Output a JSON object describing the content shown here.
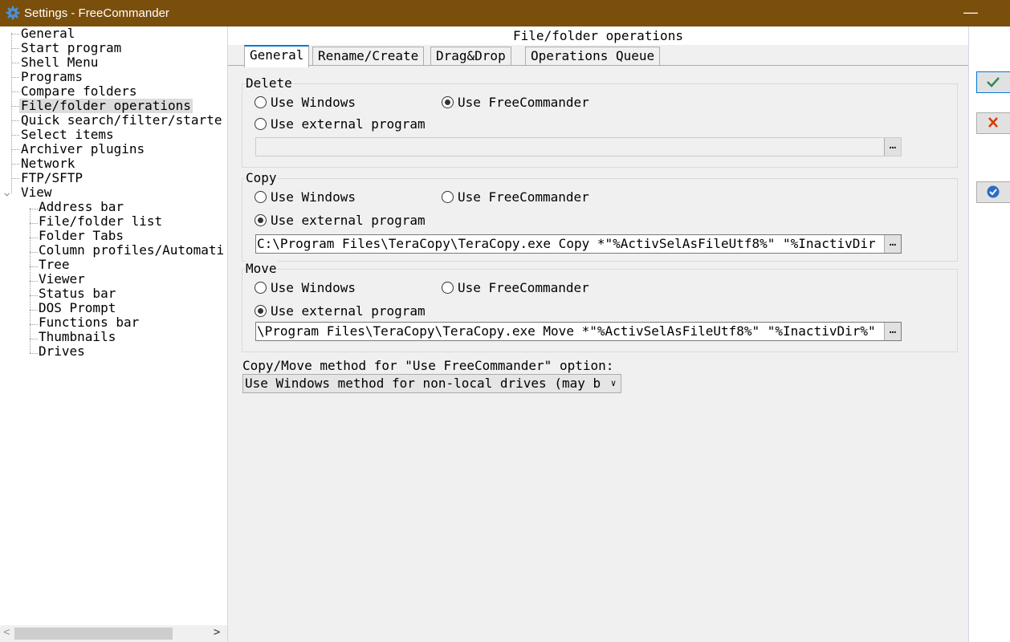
{
  "window": {
    "title": "Settings - FreeCommander",
    "minimize": "—"
  },
  "tree": {
    "items": [
      "General",
      "Start program",
      "Shell Menu",
      "Programs",
      "Compare folders",
      "File/folder operations",
      "Quick search/filter/starte",
      "Select items",
      "Archiver plugins",
      "Network",
      "FTP/SFTP",
      "View"
    ],
    "view_children": [
      "Address bar",
      "File/folder list",
      "Folder Tabs",
      "Column profiles/Automati",
      "Tree",
      "Viewer",
      "Status bar",
      "DOS Prompt",
      "Functions bar",
      "Thumbnails",
      "Drives"
    ],
    "selected": "File/folder operations"
  },
  "panel": {
    "title": "File/folder operations",
    "tabs": [
      "General",
      "Rename/Create",
      "Drag&Drop",
      "Operations Queue"
    ],
    "active_tab": "General",
    "delete": {
      "label": "Delete",
      "use_windows": "Use Windows",
      "use_freecommander": "Use FreeCommander",
      "use_external": "Use external program",
      "selected": "use_freecommander",
      "program": ""
    },
    "copy": {
      "label": "Copy",
      "use_windows": "Use Windows",
      "use_freecommander": "Use FreeCommander",
      "use_external": "Use external program",
      "selected": "use_external",
      "program": "C:\\Program Files\\TeraCopy\\TeraCopy.exe Copy *\"%ActivSelAsFileUtf8%\" \"%InactivDir"
    },
    "move": {
      "label": "Move",
      "use_windows": "Use Windows",
      "use_freecommander": "Use FreeCommander",
      "use_external": "Use external program",
      "selected": "use_external",
      "program": "\\Program Files\\TeraCopy\\TeraCopy.exe Move *\"%ActivSelAsFileUtf8%\" \"%InactivDir%\""
    },
    "browse_label": "…",
    "method_label": "Copy/Move method for \"Use FreeCommander\" option:",
    "method_value": "Use Windows method for non-local drives (may b"
  },
  "colors": {
    "titlebar": "#7a4e0b",
    "accent": "#0078d7",
    "ok": "#2e8b57",
    "cancel": "#d83b01"
  }
}
